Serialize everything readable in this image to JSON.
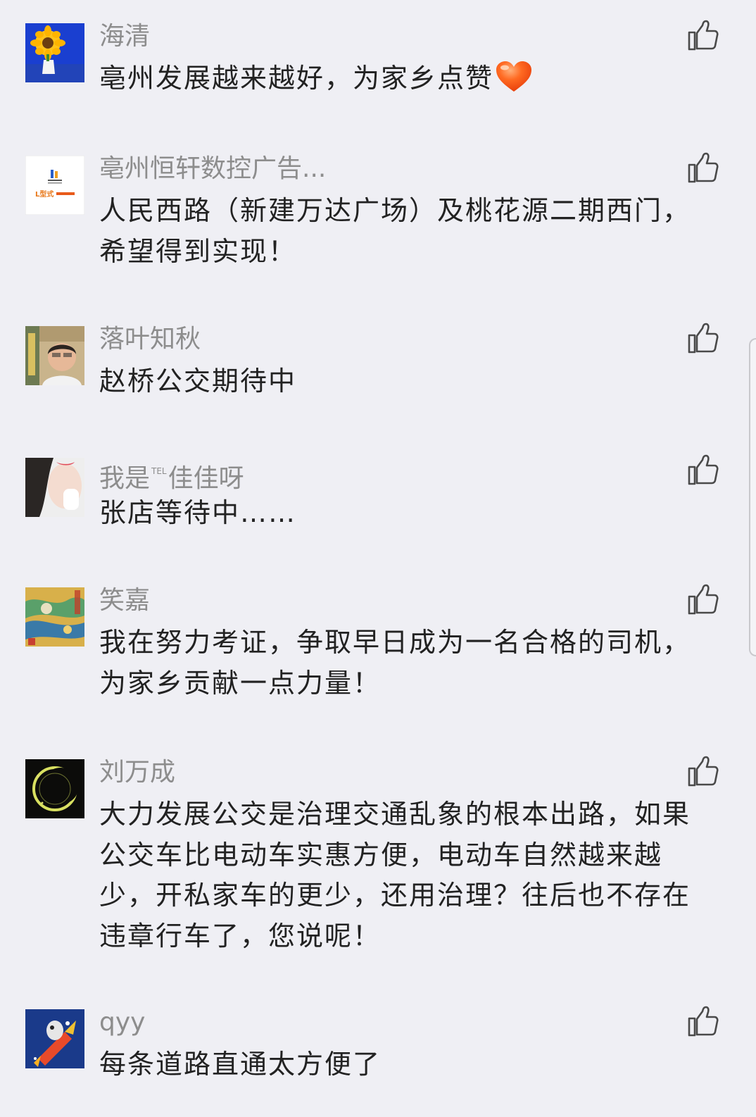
{
  "comments": [
    {
      "name": "海清",
      "text": "亳州发展越来越好，为家乡点赞"
    },
    {
      "name": "亳州恒轩数控广告...",
      "text": "人民西路（新建万达广场）及桃花源二期西门，希望得到实现！",
      "avatar_label": "L型式"
    },
    {
      "name": "落叶知秋",
      "text": "赵桥公交期待中"
    },
    {
      "name_prefix": "我是",
      "name_sup": "TEL",
      "name_suffix": "佳佳呀",
      "text": "张店等待中……"
    },
    {
      "name": "笑嘉",
      "text": "我在努力考证，争取早日成为一名合格的司机，为家乡贡献一点力量！"
    },
    {
      "name": "刘万成",
      "text": "大力发展公交是治理交通乱象的根本出路，如果公交车比电动车实惠方便，电动车自然越来越少，开私家车的更少，还用治理？往后也不存在违章行车了，您说呢！"
    },
    {
      "name": "qyy",
      "text": "每条道路直通太方便了"
    }
  ],
  "icons": {
    "like": "thumbs-up-outline-icon",
    "heart": "heart-emoji-icon"
  },
  "colors": {
    "background": "#efeff4",
    "name": "#8d8d8d",
    "text": "#222222",
    "like_icon": "#4a4a4a",
    "heart": "#ff5a1f"
  }
}
